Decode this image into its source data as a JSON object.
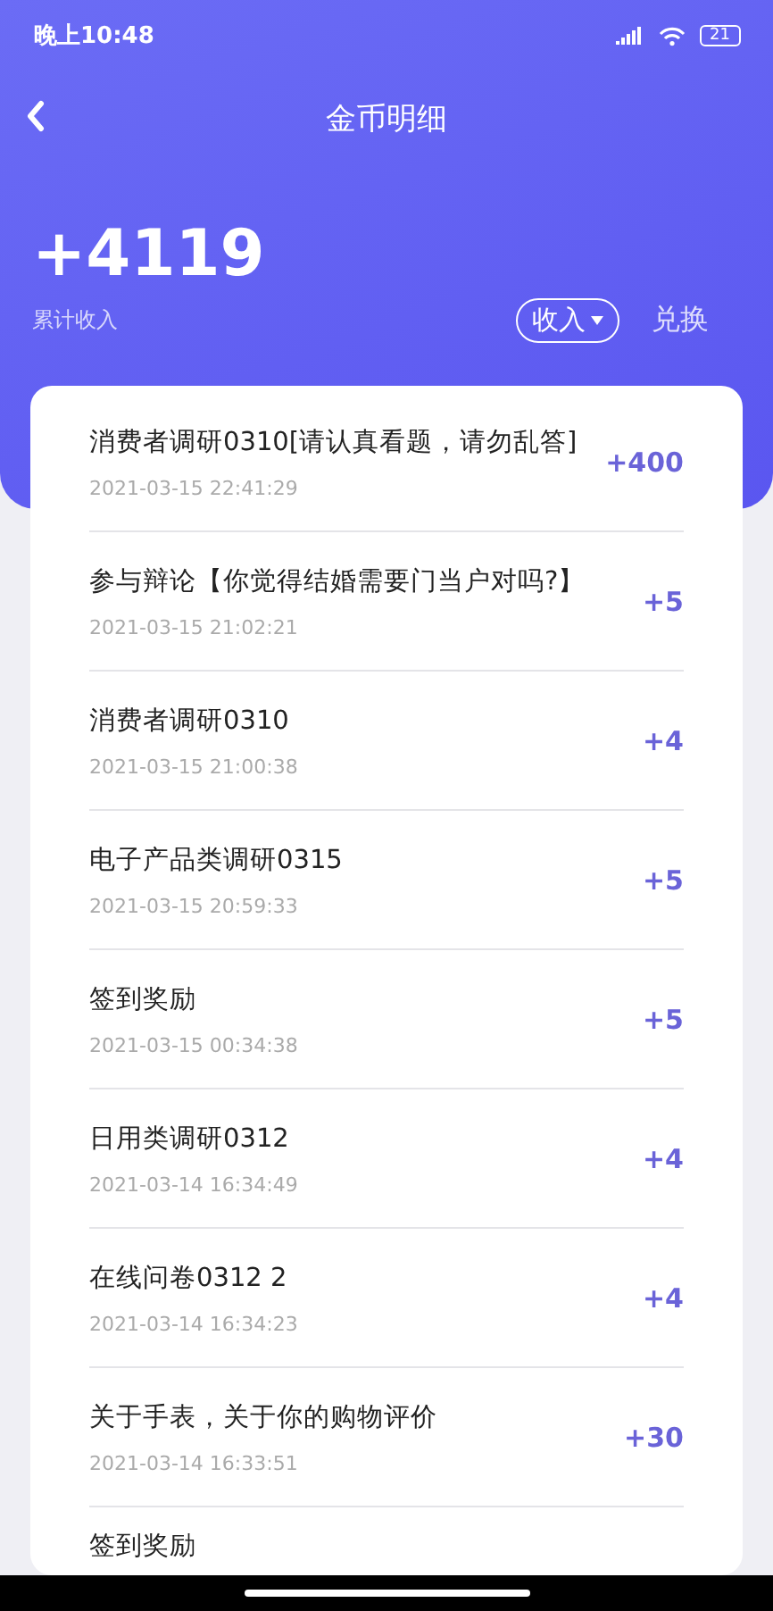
{
  "status_bar": {
    "time": "晚上10:48",
    "battery": "21"
  },
  "nav": {
    "title": "金币明细"
  },
  "summary": {
    "total": "+4119",
    "label": "累计收入",
    "filter": "收入",
    "exchange": "兑换"
  },
  "records": [
    {
      "title": "消费者调研0310[请认真看题，请勿乱答]",
      "date": "2021-03-15 22:41:29",
      "amount": "+400"
    },
    {
      "title": "参与辩论【你觉得结婚需要门当户对吗?】",
      "date": "2021-03-15 21:02:21",
      "amount": "+5"
    },
    {
      "title": "消费者调研0310",
      "date": "2021-03-15 21:00:38",
      "amount": "+4"
    },
    {
      "title": "电子产品类调研0315",
      "date": "2021-03-15 20:59:33",
      "amount": "+5"
    },
    {
      "title": "签到奖励",
      "date": "2021-03-15 00:34:38",
      "amount": "+5"
    },
    {
      "title": "日用类调研0312",
      "date": "2021-03-14 16:34:49",
      "amount": "+4"
    },
    {
      "title": "在线问卷0312 2",
      "date": "2021-03-14 16:34:23",
      "amount": "+4"
    },
    {
      "title": "关于手表，关于你的购物评价",
      "date": "2021-03-14 16:33:51",
      "amount": "+30"
    },
    {
      "title": "签到奖励"
    }
  ]
}
